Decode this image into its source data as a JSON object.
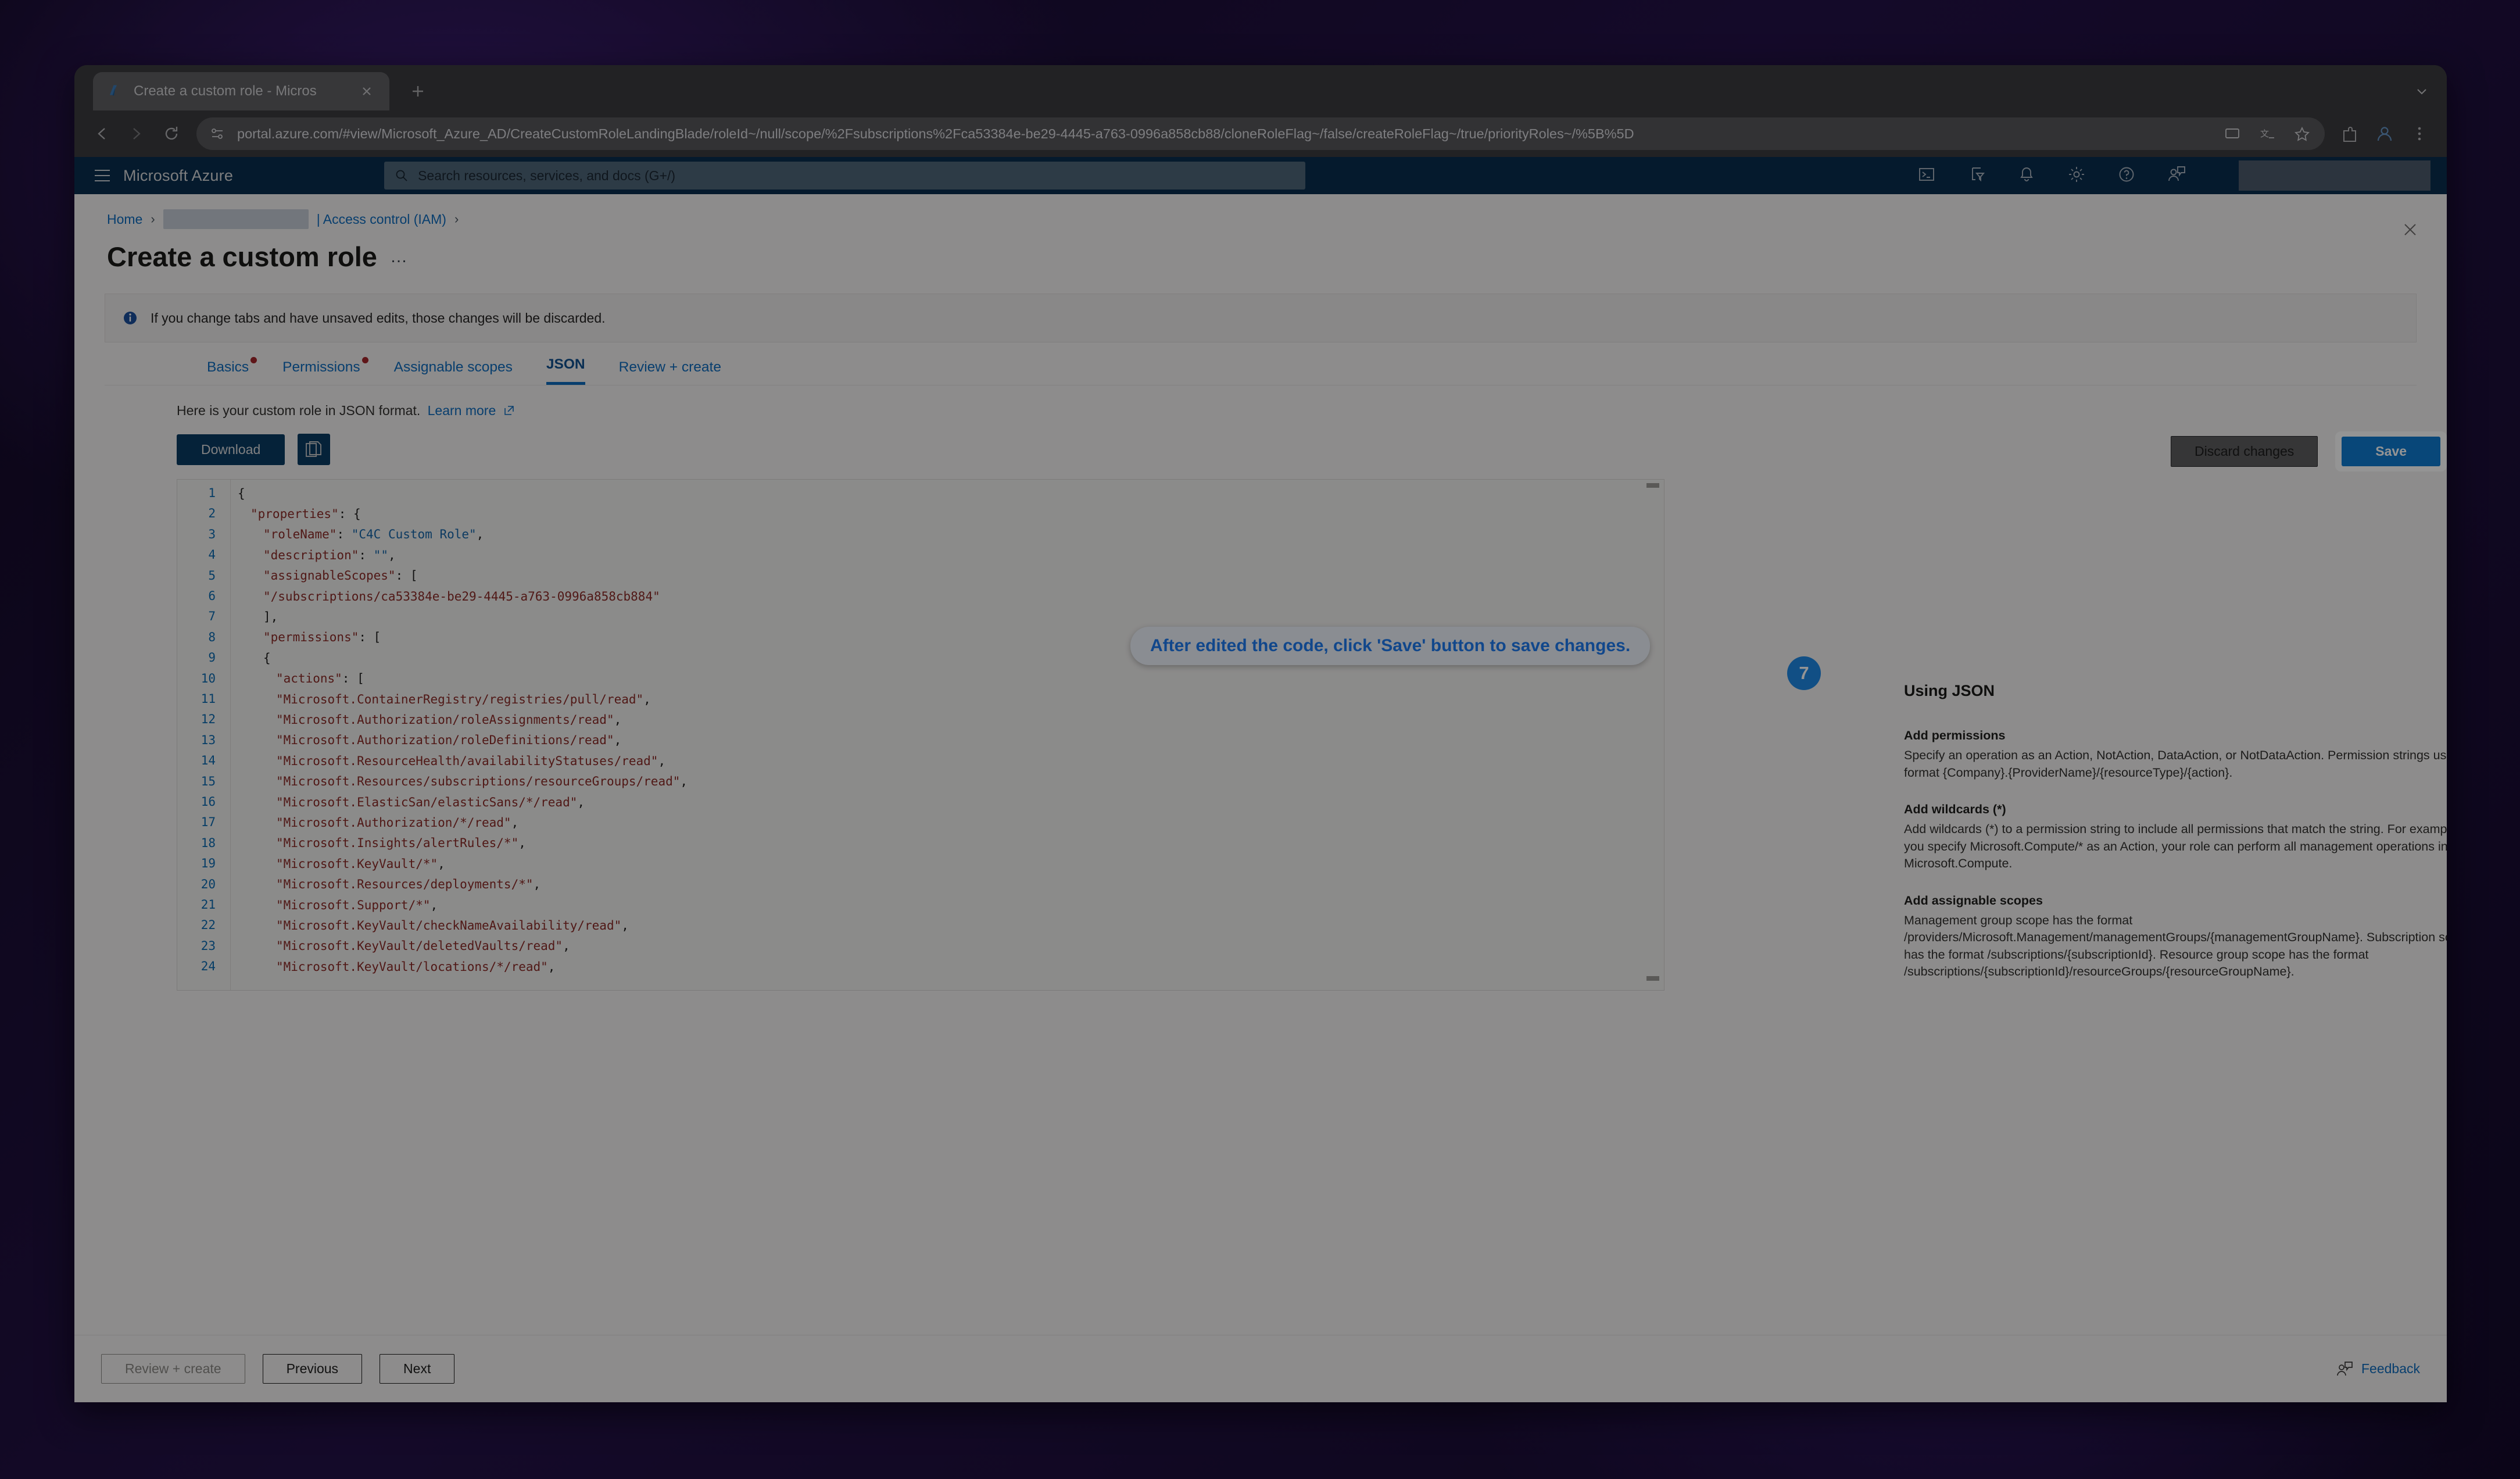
{
  "browser": {
    "tab": {
      "title": "Create a custom role - Micros",
      "favicon_icon": "azure-logo-icon",
      "close_icon": "close-icon"
    },
    "new_tab_icon": "plus-icon",
    "nav": {
      "back_icon": "back-arrow-icon",
      "forward_icon": "forward-arrow-icon",
      "reload_icon": "reload-icon"
    },
    "omnibox": {
      "site_info_icon": "site-settings-icon",
      "url": "portal.azure.com/#view/Microsoft_Azure_AD/CreateCustomRoleLandingBlade/roleId~/null/scope/%2Fsubscriptions%2Fca53384e-be29-4445-a763-0996a858cb88/cloneRoleFlag~/false/createRoleFlag~/true/priorityRoles~/%5B%5D",
      "cast_icon": "cast-icon",
      "translate_icon": "translate-icon",
      "bookmark_icon": "star-icon",
      "extensions_icon": "extensions-icon",
      "profile_icon": "profile-icon",
      "menu_icon": "three-dot-menu-icon"
    },
    "window_controls": {
      "minimize_icon": "minimize-icon",
      "maximize_icon": "maximize-icon",
      "close_icon": "window-close-icon"
    }
  },
  "azure_header": {
    "menu_icon": "hamburger-menu-icon",
    "brand": "Microsoft Azure",
    "search_placeholder": "Search resources, services, and docs (G+/)",
    "search_icon": "search-icon",
    "icons": [
      {
        "name": "cloud-shell-icon"
      },
      {
        "name": "directories-subscriptions-icon"
      },
      {
        "name": "notifications-bell-icon"
      },
      {
        "name": "settings-gear-icon"
      },
      {
        "name": "help-question-icon"
      },
      {
        "name": "feedback-icon"
      }
    ]
  },
  "blade": {
    "breadcrumb": {
      "home": "Home",
      "redacted": "",
      "access_control": "| Access control (IAM)",
      "separator": "›"
    },
    "title": "Create a custom role",
    "more_actions": "…",
    "close_icon": "close-icon",
    "info_banner": {
      "icon": "info-icon",
      "text": "If you change tabs and have unsaved edits, those changes will be discarded."
    },
    "tabs": [
      {
        "label": "Basics",
        "required": true,
        "active": false
      },
      {
        "label": "Permissions",
        "required": true,
        "active": false
      },
      {
        "label": "Assignable scopes",
        "required": false,
        "active": false
      },
      {
        "label": "JSON",
        "required": false,
        "active": true
      },
      {
        "label": "Review + create",
        "required": false,
        "active": false
      }
    ],
    "subtitle": "Here is your custom role in JSON format.",
    "subtitle_link": "Learn more",
    "subtitle_link_icon": "external-link-icon",
    "toolbar": {
      "download_label": "Download",
      "copy_icon": "copy-icon",
      "discard_label": "Discard changes",
      "save_label": "Save"
    },
    "footer": {
      "review_create_label": "Review + create",
      "review_create_disabled": true,
      "previous_label": "Previous",
      "next_label": "Next",
      "feedback_label": "Feedback",
      "feedback_icon": "feedback-icon"
    }
  },
  "callout": {
    "text": "After edited the code, click 'Save' button to save changes.",
    "step_number": "7",
    "accent_color": "#1e7bf0",
    "badge_color": "#1e88e5"
  },
  "editor": {
    "line_numbers": [
      1,
      2,
      3,
      4,
      5,
      6,
      7,
      8,
      9,
      10,
      11,
      12,
      13,
      14,
      15,
      16,
      17,
      18,
      19,
      20,
      21,
      22,
      23,
      24
    ],
    "lines": [
      {
        "n": 1,
        "indent": 0,
        "tokens": [
          {
            "t": "punct",
            "v": "{"
          }
        ]
      },
      {
        "n": 2,
        "indent": 1,
        "tokens": [
          {
            "t": "key",
            "v": "\"properties\""
          },
          {
            "t": "punct",
            "v": ": {"
          }
        ]
      },
      {
        "n": 3,
        "indent": 2,
        "tokens": [
          {
            "t": "key",
            "v": "\"roleName\""
          },
          {
            "t": "punct",
            "v": ": "
          },
          {
            "t": "str",
            "v": "\"C4C Custom Role\""
          },
          {
            "t": "punct",
            "v": ","
          }
        ]
      },
      {
        "n": 4,
        "indent": 2,
        "tokens": [
          {
            "t": "key",
            "v": "\"description\""
          },
          {
            "t": "punct",
            "v": ": "
          },
          {
            "t": "str",
            "v": "\"\""
          },
          {
            "t": "punct",
            "v": ","
          }
        ]
      },
      {
        "n": 5,
        "indent": 2,
        "tokens": [
          {
            "t": "key",
            "v": "\"assignableScopes\""
          },
          {
            "t": "punct",
            "v": ": ["
          }
        ]
      },
      {
        "n": 6,
        "indent": 2,
        "tokens": [
          {
            "t": "strd",
            "v": "\"/subscriptions/ca53384e-be29-4445-a763-0996a858cb884\""
          }
        ]
      },
      {
        "n": 7,
        "indent": 2,
        "tokens": [
          {
            "t": "punct",
            "v": "],"
          }
        ]
      },
      {
        "n": 8,
        "indent": 2,
        "tokens": [
          {
            "t": "key",
            "v": "\"permissions\""
          },
          {
            "t": "punct",
            "v": ": ["
          }
        ]
      },
      {
        "n": 9,
        "indent": 2,
        "tokens": [
          {
            "t": "punct",
            "v": "{"
          }
        ]
      },
      {
        "n": 10,
        "indent": 3,
        "tokens": [
          {
            "t": "key",
            "v": "\"actions\""
          },
          {
            "t": "punct",
            "v": ": ["
          }
        ]
      },
      {
        "n": 11,
        "indent": 3,
        "tokens": [
          {
            "t": "strd",
            "v": "\"Microsoft.ContainerRegistry/registries/pull/read\""
          },
          {
            "t": "punct",
            "v": ","
          }
        ]
      },
      {
        "n": 12,
        "indent": 3,
        "tokens": [
          {
            "t": "strd",
            "v": "\"Microsoft.Authorization/roleAssignments/read\""
          },
          {
            "t": "punct",
            "v": ","
          }
        ]
      },
      {
        "n": 13,
        "indent": 3,
        "tokens": [
          {
            "t": "strd",
            "v": "\"Microsoft.Authorization/roleDefinitions/read\""
          },
          {
            "t": "punct",
            "v": ","
          }
        ]
      },
      {
        "n": 14,
        "indent": 3,
        "tokens": [
          {
            "t": "strd",
            "v": "\"Microsoft.ResourceHealth/availabilityStatuses/read\""
          },
          {
            "t": "punct",
            "v": ","
          }
        ]
      },
      {
        "n": 15,
        "indent": 3,
        "tokens": [
          {
            "t": "strd",
            "v": "\"Microsoft.Resources/subscriptions/resourceGroups/read\""
          },
          {
            "t": "punct",
            "v": ","
          }
        ]
      },
      {
        "n": 16,
        "indent": 3,
        "tokens": [
          {
            "t": "strd",
            "v": "\"Microsoft.ElasticSan/elasticSans/*/read\""
          },
          {
            "t": "punct",
            "v": ","
          }
        ]
      },
      {
        "n": 17,
        "indent": 3,
        "tokens": [
          {
            "t": "strd",
            "v": "\"Microsoft.Authorization/*/read\""
          },
          {
            "t": "punct",
            "v": ","
          }
        ]
      },
      {
        "n": 18,
        "indent": 3,
        "tokens": [
          {
            "t": "strd",
            "v": "\"Microsoft.Insights/alertRules/*\""
          },
          {
            "t": "punct",
            "v": ","
          }
        ]
      },
      {
        "n": 19,
        "indent": 3,
        "tokens": [
          {
            "t": "strd",
            "v": "\"Microsoft.KeyVault/*\""
          },
          {
            "t": "punct",
            "v": ","
          }
        ]
      },
      {
        "n": 20,
        "indent": 3,
        "tokens": [
          {
            "t": "strd",
            "v": "\"Microsoft.Resources/deployments/*\""
          },
          {
            "t": "punct",
            "v": ","
          }
        ]
      },
      {
        "n": 21,
        "indent": 3,
        "tokens": [
          {
            "t": "strd",
            "v": "\"Microsoft.Support/*\""
          },
          {
            "t": "punct",
            "v": ","
          }
        ]
      },
      {
        "n": 22,
        "indent": 3,
        "tokens": [
          {
            "t": "strd",
            "v": "\"Microsoft.KeyVault/checkNameAvailability/read\""
          },
          {
            "t": "punct",
            "v": ","
          }
        ]
      },
      {
        "n": 23,
        "indent": 3,
        "tokens": [
          {
            "t": "strd",
            "v": "\"Microsoft.KeyVault/deletedVaults/read\""
          },
          {
            "t": "punct",
            "v": ","
          }
        ]
      },
      {
        "n": 24,
        "indent": 3,
        "tokens": [
          {
            "t": "strd",
            "v": "\"Microsoft.KeyVault/locations/*/read\""
          },
          {
            "t": "punct",
            "v": ","
          }
        ]
      }
    ]
  },
  "help": {
    "title": "Using JSON",
    "sections": [
      {
        "heading": "Add permissions",
        "body": "Specify an operation as an Action, NotAction, DataAction, or NotDataAction. Permission strings use the format {Company}.{ProviderName}/{resourceType}/{action}."
      },
      {
        "heading": "Add wildcards (*)",
        "body": "Add wildcards (*) to a permission string to include all permissions that match the string. For example, if you specify Microsoft.Compute/* as an Action, your role can perform all management operations in Microsoft.Compute."
      },
      {
        "heading": "Add assignable scopes",
        "body": "Management group scope has the format /providers/Microsoft.Management/managementGroups/{managementGroupName}. Subscription scope has the format /subscriptions/{subscriptionId}. Resource group scope has the format /subscriptions/{subscriptionId}/resourceGroups/{resourceGroupName}."
      }
    ]
  }
}
